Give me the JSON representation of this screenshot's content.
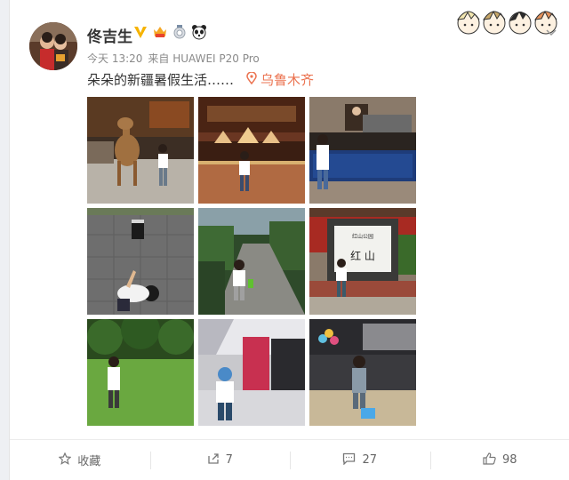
{
  "post": {
    "username": "佟吉生",
    "time": "今天 13:20",
    "source": "来自 HUAWEI P20 Pro",
    "text": "朵朵的新疆暑假生活……",
    "location": "乌鲁木齐"
  },
  "photos": [
    {
      "name": "photo-camel-kid"
    },
    {
      "name": "photo-bakery-kid"
    },
    {
      "name": "photo-restaurant-kid"
    },
    {
      "name": "photo-square-kid"
    },
    {
      "name": "photo-park-path-kid"
    },
    {
      "name": "photo-hongshan-sign-kid"
    },
    {
      "name": "photo-lawn-kid"
    },
    {
      "name": "photo-mall-kid"
    },
    {
      "name": "photo-mall-luggage-kid"
    }
  ],
  "stele": {
    "small_text": "红山公园",
    "big_text": "红 山"
  },
  "footer": {
    "favorite_label": "收藏",
    "repost_count": "7",
    "comment_count": "27",
    "like_count": "98"
  },
  "colors": {
    "accent": "#eb7350",
    "verified": "#f6b300",
    "link": "#eb7350"
  },
  "icons": [
    "verified-icon",
    "vip-crown-icon",
    "medal-icon",
    "panda-icon",
    "location-pin-icon",
    "star-icon",
    "repost-icon",
    "comment-icon",
    "like-icon",
    "chevron-down-icon"
  ]
}
